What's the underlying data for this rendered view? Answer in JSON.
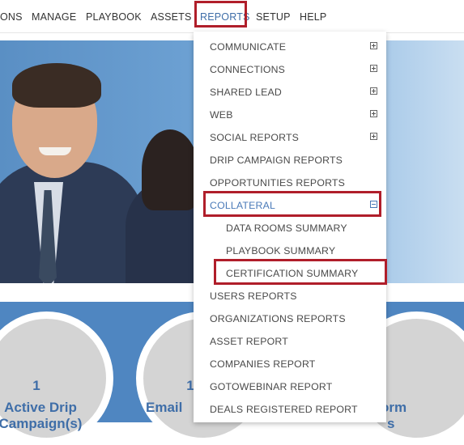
{
  "nav": {
    "items": [
      "ONS",
      "MANAGE",
      "PLAYBOOK",
      "ASSETS",
      "REPORTS",
      "SETUP",
      "HELP"
    ],
    "active": "REPORTS"
  },
  "reports_menu": {
    "items": [
      {
        "label": "COMMUNICATE",
        "expandable": true,
        "state": "collapsed"
      },
      {
        "label": "CONNECTIONS",
        "expandable": true,
        "state": "collapsed"
      },
      {
        "label": "SHARED LEAD",
        "expandable": true,
        "state": "collapsed"
      },
      {
        "label": "WEB",
        "expandable": true,
        "state": "collapsed"
      },
      {
        "label": "SOCIAL REPORTS",
        "expandable": true,
        "state": "collapsed"
      },
      {
        "label": "DRIP CAMPAIGN REPORTS"
      },
      {
        "label": "OPPORTUNITIES REPORTS"
      },
      {
        "label": "COLLATERAL",
        "expandable": true,
        "state": "expanded",
        "active": true
      },
      {
        "label": "DATA ROOMS SUMMARY",
        "level": 2
      },
      {
        "label": "PLAYBOOK SUMMARY",
        "level": 2
      },
      {
        "label": "CERTIFICATION SUMMARY",
        "level": 2
      },
      {
        "label": "USERS REPORTS"
      },
      {
        "label": "ORGANIZATIONS REPORTS"
      },
      {
        "label": "ASSET REPORT"
      },
      {
        "label": "COMPANIES REPORT"
      },
      {
        "label": "GOTOWEBINAR REPORT"
      },
      {
        "label": "DEALS REGISTERED REPORT"
      }
    ]
  },
  "stats": [
    {
      "value": "1",
      "label_line1": "Active Drip",
      "label_line2": "Campaign(s)"
    },
    {
      "value": "1",
      "label_line1": "Email"
    },
    {
      "label_line1": "orm",
      "label_line2": "s"
    }
  ],
  "colors": {
    "accent": "#3f6ea8",
    "highlight": "#b01e2a",
    "band": "#4f86c1"
  }
}
